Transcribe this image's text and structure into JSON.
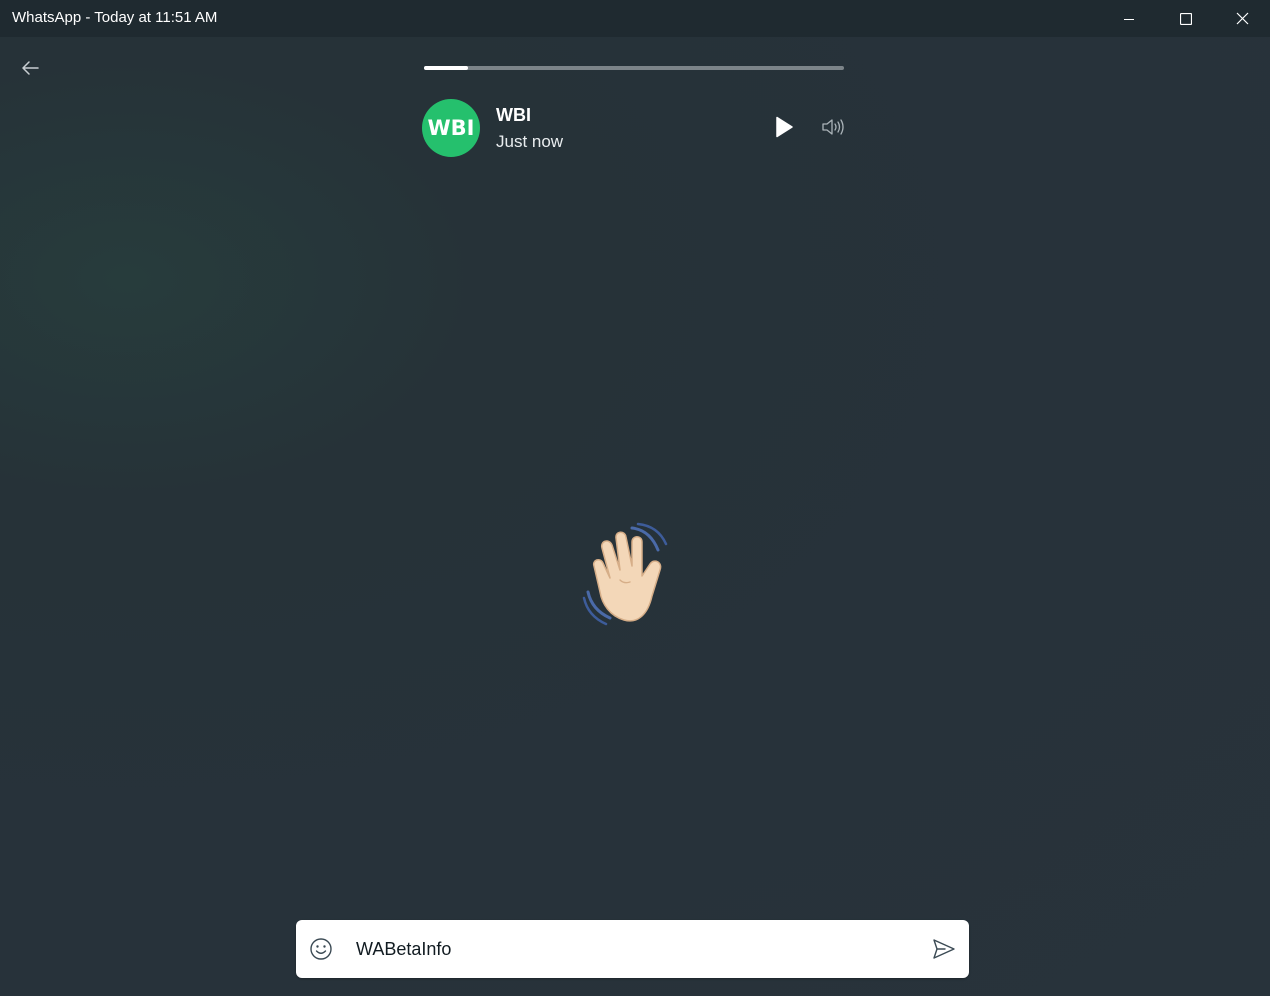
{
  "window": {
    "title": "WhatsApp - Today at 11:51 AM",
    "controls": [
      "minimize-icon",
      "maximize-icon",
      "close-icon"
    ]
  },
  "status": {
    "progress_fraction": 0.105,
    "contact": {
      "avatar_text": "WBI",
      "name": "WBI",
      "time": "Just now",
      "avatar_color": "#25c06d"
    },
    "playback_icon": "play-icon",
    "volume_icon": "volume-icon",
    "content_emoji": "waving-hand",
    "background_color": "#27323a"
  },
  "reply": {
    "value": "WABetaInfo",
    "emoji_icon": "smiley-icon",
    "send_icon": "send-icon"
  }
}
